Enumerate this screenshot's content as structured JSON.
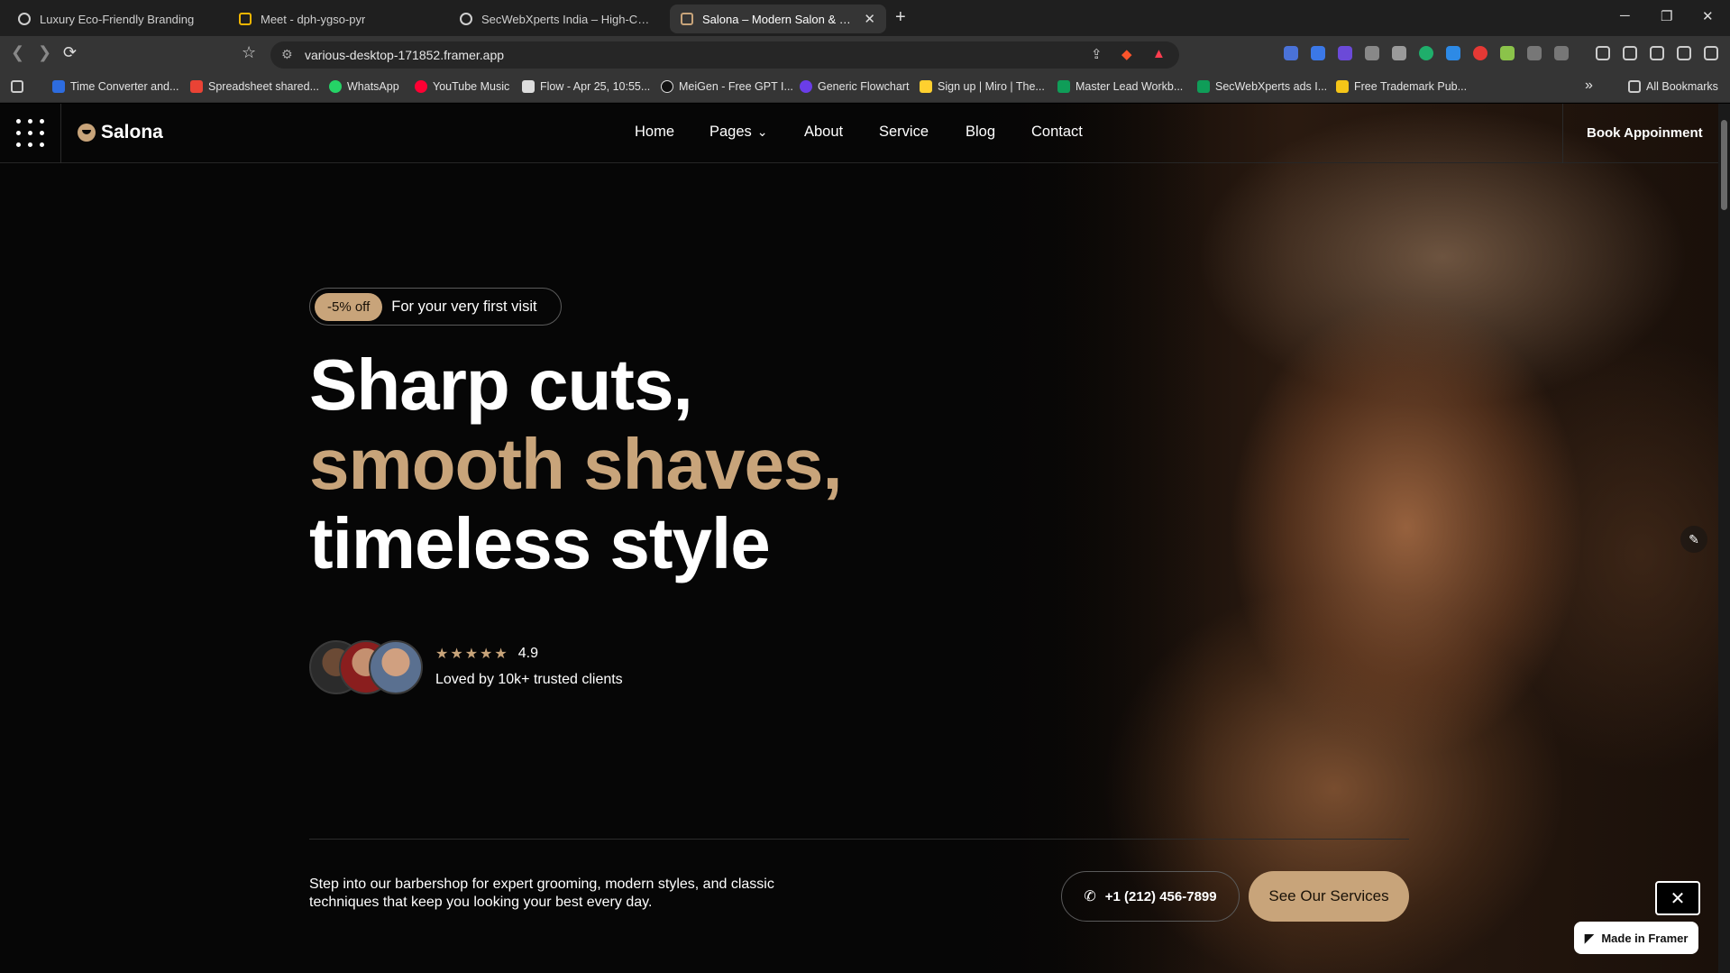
{
  "browser": {
    "tabs": [
      {
        "title": "Luxury Eco-Friendly Branding"
      },
      {
        "title": "Meet - dph-ygso-pyr"
      },
      {
        "title": "SecWebXperts India – High-Converting"
      },
      {
        "title": "Salona – Modern Salon & Spa Template",
        "active": true
      }
    ],
    "url": "various-desktop-171852.framer.app",
    "bookmarks": [
      {
        "label": "Time Converter and..."
      },
      {
        "label": "Spreadsheet shared..."
      },
      {
        "label": "WhatsApp"
      },
      {
        "label": "YouTube Music"
      },
      {
        "label": "Flow - Apr 25, 10:55..."
      },
      {
        "label": "MeiGen - Free GPT I..."
      },
      {
        "label": "Generic Flowchart"
      },
      {
        "label": "Sign up | Miro | The..."
      },
      {
        "label": "Master Lead Workb..."
      },
      {
        "label": "SecWebXperts ads I..."
      },
      {
        "label": "Free Trademark Pub..."
      }
    ],
    "all_bookmarks_label": "All Bookmarks",
    "icons": {
      "new_tab": "+",
      "tab_close": "✕",
      "minimize": "─",
      "restore": "❐",
      "close": "✕",
      "back": "❮",
      "forward": "❯",
      "reload": "⟳",
      "bookmark": "☆",
      "more_bookmarks": "»",
      "edit": "✎",
      "close_overlay": "✕",
      "phone": "✆",
      "framer": "◤"
    }
  },
  "site": {
    "logo_text": "Salona",
    "nav": {
      "home": "Home",
      "pages": "Pages",
      "about": "About",
      "service": "Service",
      "blog": "Blog",
      "contact": "Contact"
    },
    "nav_caret": "⌄",
    "cta": "Book Appoinment",
    "badge": {
      "pill": "-5% off",
      "text": "For your very first visit"
    },
    "headline": {
      "line1": "Sharp cuts,",
      "line2": "smooth shaves,",
      "line3": "timeless style"
    },
    "rating": {
      "stars": "★★★★★",
      "value": "4.9",
      "label": "Loved by 10k+ trusted clients"
    },
    "blurb": "Step into our barbershop for expert grooming, modern styles, and classic techniques that keep you looking your best every day.",
    "phone": "+1 (212) 456-7899",
    "services_btn": "See Our Services",
    "framer_badge": "Made in Framer"
  },
  "colors": {
    "accent": "#c8a47a",
    "background": "#060606",
    "text": "#ffffff"
  }
}
